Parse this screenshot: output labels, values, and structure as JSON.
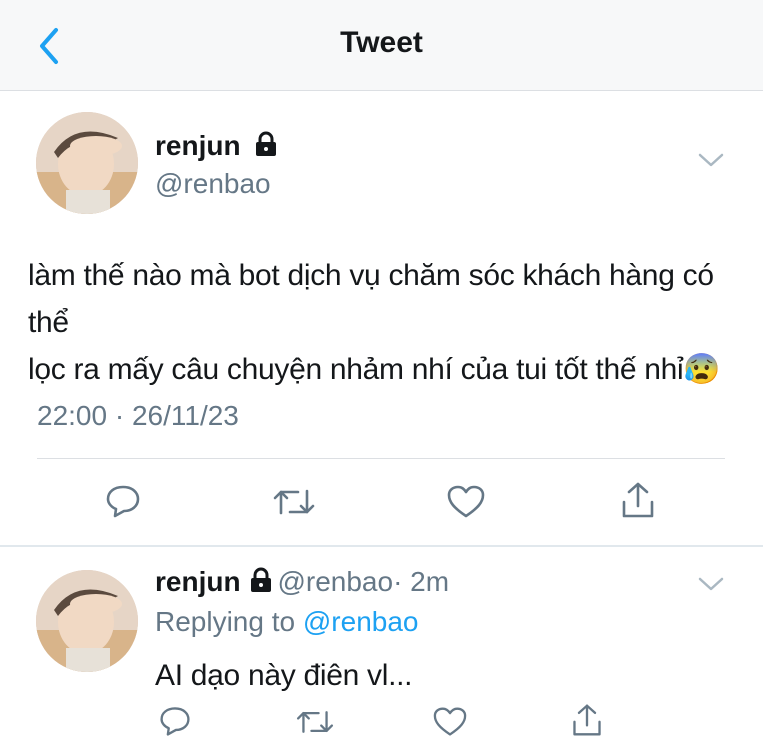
{
  "header": {
    "title": "Tweet",
    "back_icon": "chevron-left-icon"
  },
  "tweet": {
    "author_name": "renjun",
    "author_handle": "@renbao",
    "lines": [
      "làm thế nào mà bot dịch vụ chăm sóc khách hàng có thể",
      "lọc ra mấy câu chuyện nhảm nhí của tui tốt thế nhỉ"
    ],
    "emoji": "😰",
    "timestamp": "22:00 · 26/11/23",
    "actions": [
      "reply-icon",
      "retweet-icon",
      "like-icon",
      "share-icon"
    ]
  },
  "reply": {
    "author_name": "renjun",
    "author_handle": "@renbao",
    "age": "· 2m",
    "replying_prefix": "Replying to",
    "replying_to": "@renbao",
    "text": "AI dạo này điên vl..."
  },
  "colors": {
    "accent": "#1da1f2",
    "muted": "#657786",
    "text": "#14171a"
  }
}
